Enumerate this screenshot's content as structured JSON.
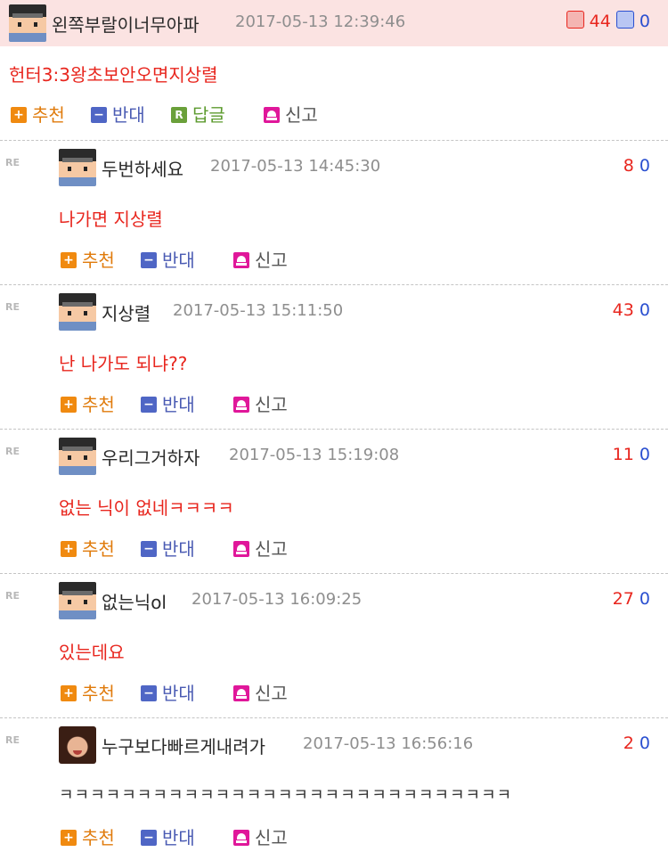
{
  "main": {
    "author": "왼쪽부랄이너무아파",
    "date": "2017-05-13 12:39:46",
    "up_count": "44",
    "down_count": "0",
    "body": "헌터3:3왕초보안오면지상렬",
    "actions": {
      "up": "추천",
      "down": "반대",
      "reply": "답글",
      "report": "신고"
    }
  },
  "re_marker": "RE",
  "comments": [
    {
      "author": "두번하세요",
      "date": "2017-05-13 14:45:30",
      "up": "8",
      "down": "0",
      "body": "나가면 지상렬",
      "actions": {
        "up": "추천",
        "down": "반대",
        "report": "신고"
      }
    },
    {
      "author": "지상렬",
      "date": "2017-05-13 15:11:50",
      "up": "43",
      "down": "0",
      "body": "난 나가도 되냐??",
      "actions": {
        "up": "추천",
        "down": "반대",
        "report": "신고"
      }
    },
    {
      "author": "우리그거하자",
      "date": "2017-05-13 15:19:08",
      "up": "11",
      "down": "0",
      "body": "없는 닉이 없네ㅋㅋㅋㅋ",
      "actions": {
        "up": "추천",
        "down": "반대",
        "report": "신고"
      }
    },
    {
      "author": "없는닉ol",
      "date": "2017-05-13 16:09:25",
      "up": "27",
      "down": "0",
      "body": "있는데요",
      "actions": {
        "up": "추천",
        "down": "반대",
        "report": "신고"
      }
    },
    {
      "author": "누구보다빠르게내려가",
      "date": "2017-05-13 16:56:16",
      "up": "2",
      "down": "0",
      "body": "ㅋㅋㅋㅋㅋㅋㅋㅋㅋㅋㅋㅋㅋㅋㅋㅋㅋㅋㅋㅋㅋㅋㅋㅋㅋㅋㅋㅋㅋ",
      "actions": {
        "up": "추천",
        "down": "반대",
        "report": "신고"
      }
    }
  ],
  "colors": {
    "header_bg": "#fbe3e2",
    "body_text": "#e8261e",
    "up": "#f08a10",
    "down": "#4f66c5",
    "reply": "#6aa03a",
    "report": "#e0179a"
  }
}
